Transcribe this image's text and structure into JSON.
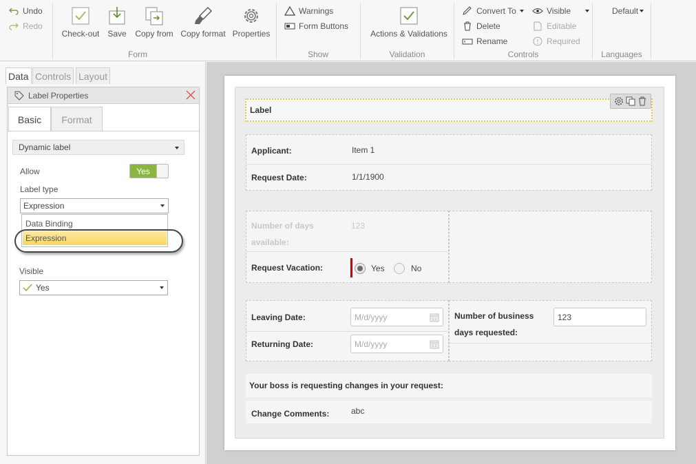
{
  "ribbon": {
    "undo": "Undo",
    "redo": "Redo",
    "form": {
      "checkout": "Check-out",
      "save": "Save",
      "copy_from": "Copy from",
      "copy_format": "Copy format",
      "properties": "Properties",
      "label": "Form"
    },
    "show": {
      "warnings": "Warnings",
      "form_buttons": "Form Buttons",
      "label": "Show"
    },
    "validation": {
      "actions": "Actions & Validations",
      "label": "Validation"
    },
    "controls": {
      "convert_to": "Convert To",
      "delete": "Delete",
      "rename": "Rename",
      "visible": "Visible",
      "editable": "Editable",
      "required": "Required",
      "label": "Controls"
    },
    "languages": {
      "default": "Default",
      "label": "Languages"
    }
  },
  "left_tabs": [
    "Data",
    "Controls",
    "Layout"
  ],
  "properties": {
    "title": "Label Properties",
    "tabs": [
      "Basic",
      "Format"
    ],
    "section": "Dynamic label",
    "allow_label": "Allow",
    "allow_value": "Yes",
    "label_type_label": "Label type",
    "label_type_value": "Expression",
    "label_type_options": [
      "Data Binding",
      "Expression"
    ],
    "visible_label": "Visible",
    "visible_value": "Yes"
  },
  "form": {
    "label_title": "Label",
    "applicant_label": "Applicant:",
    "applicant_value": "Item 1",
    "request_date_label": "Request Date:",
    "request_date_value": "1/1/1900",
    "days_available_label_1": "Number of days",
    "days_available_label_2": "available:",
    "days_available_value": "123",
    "request_vacation_label": "Request Vacation:",
    "radio_yes": "Yes",
    "radio_no": "No",
    "leaving_label": "Leaving Date:",
    "leaving_placeholder": "M/d/yyyy",
    "returning_label": "Returning Date:",
    "returning_placeholder": "M/d/yyyy",
    "business_days_label_1": "Number of business",
    "business_days_label_2": "days requested:",
    "business_days_value": "123",
    "boss_text": "Your boss is requesting changes in your request:",
    "change_comments_label": "Change Comments:",
    "change_comments_value": "abc"
  },
  "colors": {
    "accent_green": "#8ab63f",
    "highlight_yellow": "#fbe07a",
    "required_red": "#d00000"
  }
}
